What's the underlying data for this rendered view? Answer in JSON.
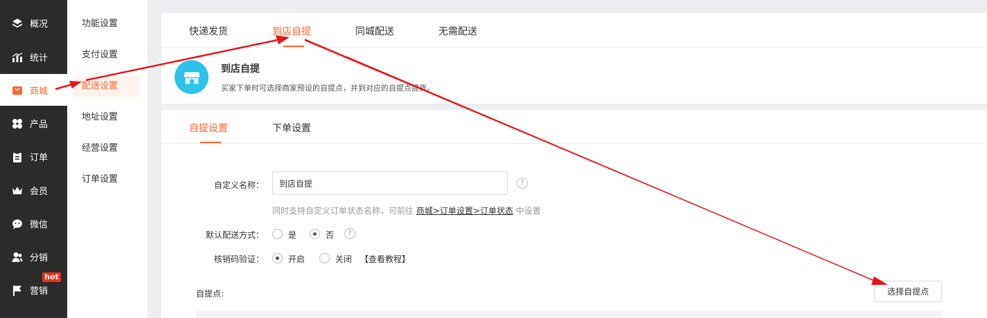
{
  "sidebar": {
    "items": [
      {
        "label": "概况",
        "icon": "layers-icon"
      },
      {
        "label": "统计",
        "icon": "stats-icon"
      },
      {
        "label": "商城",
        "icon": "shop-bag-icon",
        "active": true
      },
      {
        "label": "产品",
        "icon": "clover-icon"
      },
      {
        "label": "订单",
        "icon": "clipboard-icon"
      },
      {
        "label": "会员",
        "icon": "crown-icon"
      },
      {
        "label": "微信",
        "icon": "wechat-icon"
      },
      {
        "label": "分销",
        "icon": "users-icon"
      },
      {
        "label": "营销",
        "icon": "flag-icon",
        "badge": "hot"
      }
    ]
  },
  "subsidebar": {
    "items": [
      "功能设置",
      "支付设置",
      "配送设置",
      "地址设置",
      "经营设置",
      "订单设置"
    ],
    "active_index": 2
  },
  "delivery_tabs": [
    "快递发货",
    "到店自提",
    "同城配送",
    "无需配送"
  ],
  "delivery_active_index": 1,
  "store": {
    "icon": "store-icon",
    "title": "到店自提",
    "desc": "买家下单时可选择商家预设的自提点，并到对应的自提点提货。"
  },
  "settings_tabs": [
    "自提设置",
    "下单设置"
  ],
  "settings_active_index": 0,
  "form": {
    "name_label": "自定义名称：",
    "name_value": "到店自提",
    "help": "?",
    "hint_prefix": "同时支持自定义订单状态名称，可前往",
    "hint_link": "商城>订单设置>订单状态",
    "hint_suffix": "中设置",
    "default_label": "默认配送方式：",
    "default_yes": "是",
    "default_no": "否",
    "default_selected": "否",
    "verify_label": "核销码验证：",
    "verify_on": "开启",
    "verify_off": "关闭",
    "verify_selected": "开启",
    "tutorial": "【查看教程】",
    "pickup_label": "自提点:",
    "select_button": "选择自提点"
  },
  "colors": {
    "accent": "#ff6633",
    "sidebar_bg": "#2b2b2b",
    "store_icon_bg": "#2ec3e8",
    "annotation_arrow": "#e8141c",
    "hot_badge": "#e8341c"
  }
}
